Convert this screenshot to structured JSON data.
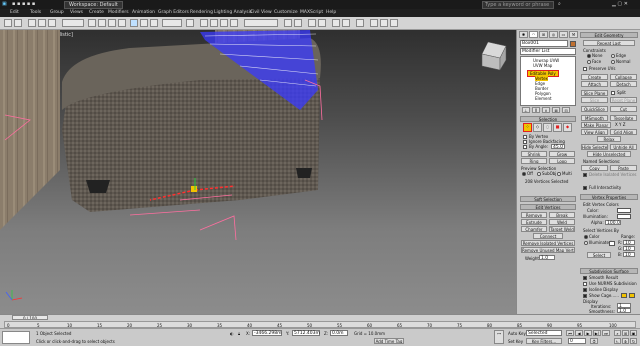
{
  "titlebar": {
    "workspace": "Workspace: Default",
    "search_placeholder": "Type a keyword or phrase"
  },
  "menu": [
    "Edit",
    "Tools",
    "Group",
    "Views",
    "Create",
    "Modifiers",
    "Animation",
    "Graph Editors",
    "Rendering",
    "Lighting Analysis",
    "Civil View",
    "Customize",
    "MAXScript",
    "Help"
  ],
  "viewport": {
    "label": "[+] [Perspective] [Realistic]"
  },
  "panel": {
    "object_name": "Box001",
    "modifier_list": "Modifier List",
    "stack": [
      {
        "label": "Unwrap UVW",
        "icon": "bulb-icon"
      },
      {
        "label": "UVW Map",
        "icon": "bulb-icon"
      },
      {
        "label": "Editable Poly",
        "icon": "bulb-icon"
      },
      {
        "label": "Vertex"
      },
      {
        "label": "Edge"
      },
      {
        "label": "Border"
      },
      {
        "label": "Polygon"
      },
      {
        "label": "Element"
      }
    ],
    "selection_title": "Selection",
    "by_vertex": "By Vertex",
    "ignore_backfacing": "Ignore Backfacing",
    "by_angle": "By Angle:",
    "angle_value": "45.0",
    "shrink": "Shrink",
    "grow": "Grow",
    "ring": "Ring",
    "loop": "Loop",
    "preview_selection": "Preview Selection",
    "off": "Off",
    "subobj": "SubObj",
    "multi": "Multi",
    "selected_count": "208 Vertices Selected",
    "soft_selection": "Soft Selection",
    "edit_vertices": "Edit Vertices",
    "remove": "Remove",
    "break": "Break",
    "extrude": "Extrude",
    "weld": "Weld",
    "chamfer": "Chamfer",
    "target_weld": "Target Weld",
    "connect": "Connect",
    "remove_isolated": "Remove Isolated Vertices",
    "remove_unused": "Remove Unused Map Verts",
    "weight_label": "Weight:",
    "weight_value": "1.0",
    "edit_geometry": "Edit Geometry",
    "repeat_last": "Repeat Last",
    "constraints": "Constraints",
    "none": "None",
    "edge": "Edge",
    "face": "Face",
    "normal": "Normal",
    "preserve_uvs": "Preserve UVs",
    "create": "Create",
    "collapse": "Collapse",
    "attach": "Attach",
    "detach": "Detach",
    "slice_plane": "Slice Plane",
    "split": "Split",
    "slice": "Slice",
    "reset_plane": "Reset Plane",
    "quickslice": "QuickSlice",
    "cut": "Cut",
    "msmooth": "MSmooth",
    "tessellate": "Tessellate",
    "make_planar": "Make Planar",
    "view_align": "View Align",
    "grid_align": "Grid Align",
    "relax": "Relax",
    "hide_selected": "Hide Selected",
    "unhide_all": "Unhide All",
    "hide_unselected": "Hide Unselected",
    "named_selections": "Named Selections:",
    "copy": "Copy",
    "paste": "Paste",
    "delete_isolated": "Delete Isolated Vertices",
    "full_interactivity": "Full Interactivity",
    "subdivision_surface": "Subdivision Surface",
    "smooth_result": "Smooth Result",
    "use_nurms": "Use NURMS Subdivision",
    "isoline_display": "Isoline Display",
    "show_cage": "Show Cage......",
    "display": "Display",
    "iterations": "Iterations:",
    "iterations_value": "1",
    "smoothness": "Smoothness:",
    "smoothness_value": "1.0",
    "render": "Render",
    "vertex_props": "Vertex Properties",
    "edit_vertex_colors": "Edit Vertex Colors",
    "color": "Color:",
    "illumination": "Illumination:",
    "alpha": "Alpha:",
    "alpha_value": "100.0",
    "select_vertices_by": "Select Vertices By",
    "color_opt": "Color",
    "illuminated_opt": "Illuminated",
    "range": "Range:",
    "r": "R:",
    "g": "G:",
    "b": "B:",
    "range_value": "10",
    "select": "Select"
  },
  "timeline": {
    "frame": "0 / 100",
    "ticks": [
      "0",
      "5",
      "10",
      "15",
      "20",
      "25",
      "30",
      "35",
      "40",
      "45",
      "50",
      "55",
      "60",
      "65",
      "70",
      "75",
      "80",
      "85",
      "90",
      "95",
      "100"
    ]
  },
  "status": {
    "selected": "1 Object Selected",
    "prompt": "Click or click-and-drag to select objects",
    "x_label": "X:",
    "x_value": "-3466.298m",
    "y_label": "Y:",
    "y_value": "5712.403m",
    "z_label": "Z:",
    "z_value": "0.0m",
    "grid": "Grid = 10.0mm",
    "add_time_tag": "Add Time Tag",
    "auto_key": "Auto Key",
    "selected_dropdown": "Selected",
    "set_key": "Set Key",
    "key_filters": "Key Filters...",
    "frame_value": "0"
  },
  "colors": {
    "accent_yellow": "#f2c300",
    "selection_red": "#e02020",
    "panel_bg": "#c7c7c7"
  }
}
